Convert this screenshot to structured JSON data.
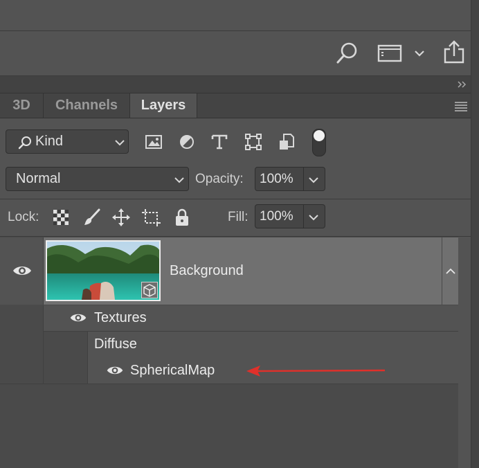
{
  "tabs": [
    {
      "label": "3D"
    },
    {
      "label": "Channels"
    },
    {
      "label": "Layers"
    }
  ],
  "filter": {
    "kind_label": "Kind"
  },
  "blend": {
    "mode": "Normal",
    "opacity_label": "Opacity:",
    "opacity_value": "100%"
  },
  "lock": {
    "label": "Lock:",
    "fill_label": "Fill:",
    "fill_value": "100%"
  },
  "layers": {
    "background_name": "Background",
    "textures_label": "Textures",
    "diffuse_label": "Diffuse",
    "spherical_map_label": "SphericalMap"
  },
  "colors": {
    "panel": "#535353",
    "annotation_arrow": "#e0302a"
  }
}
